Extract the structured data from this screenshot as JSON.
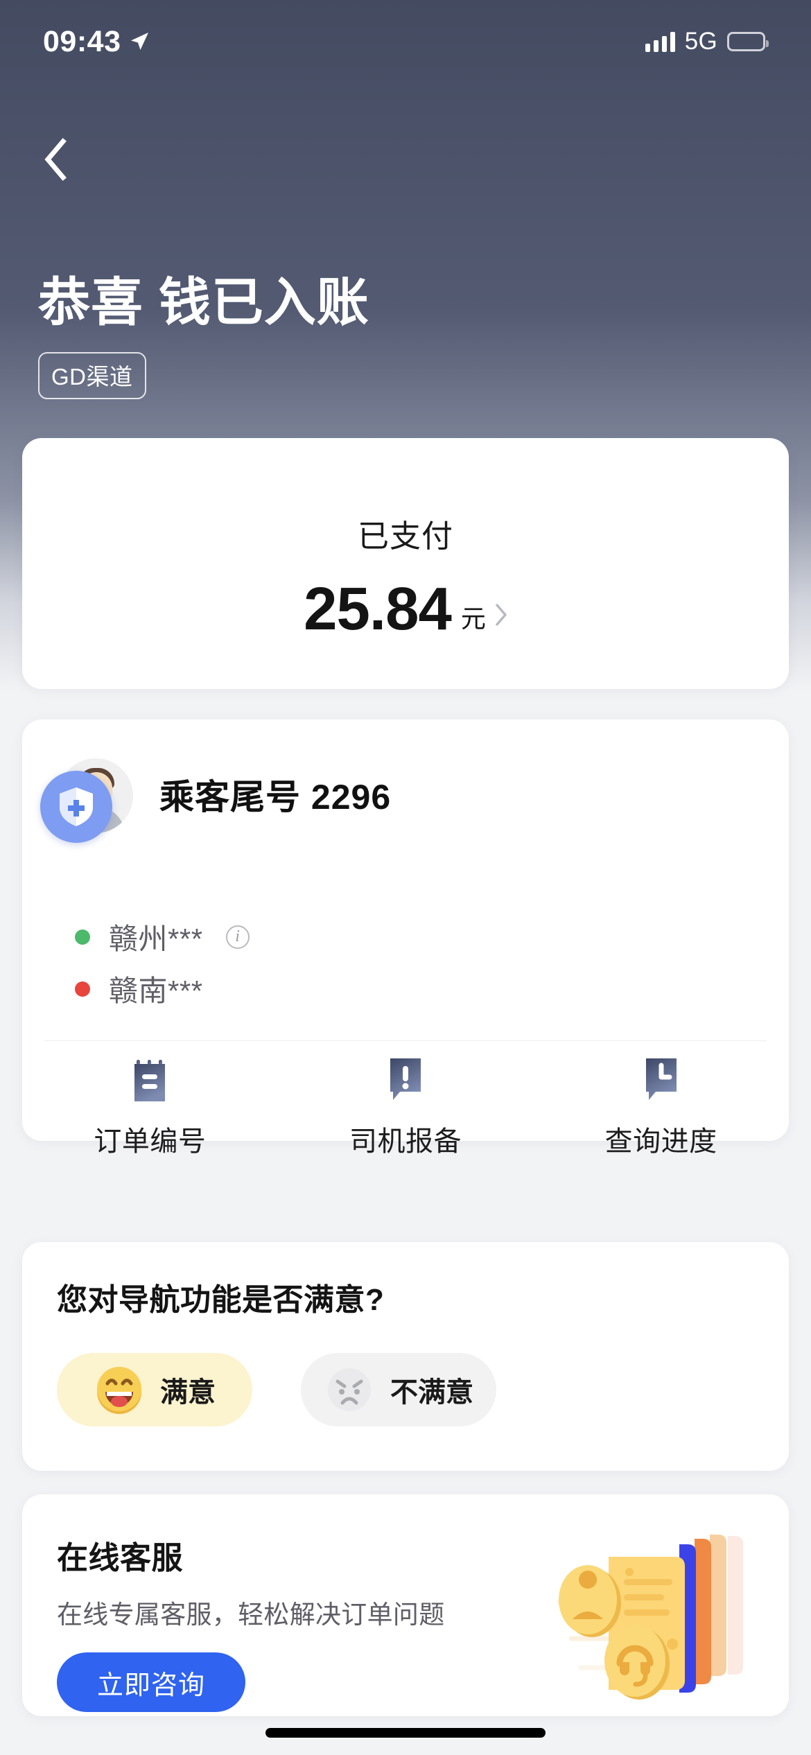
{
  "status_bar": {
    "time": "09:43",
    "location_arrow": "location-arrow-icon",
    "signal": "signal-bars-icon",
    "network": "5G",
    "battery": "battery-icon"
  },
  "navbar": {
    "back": "back-chevron-icon"
  },
  "header": {
    "title": "恭喜 钱已入账",
    "badge": "GD渠道"
  },
  "payment": {
    "label": "已支付",
    "amount": "25.84",
    "unit": "元",
    "chevron": "chevron-right-icon"
  },
  "passenger": {
    "avatar": "passenger-avatar",
    "shield_badge": "shield-plus-icon",
    "name": "乘客尾号 2296",
    "origin": "赣州***",
    "origin_info": "info-icon",
    "destination": "赣南***"
  },
  "actions": [
    {
      "label": "订单编号",
      "icon": "order-note-icon"
    },
    {
      "label": "司机报备",
      "icon": "alert-bubble-icon"
    },
    {
      "label": "查询进度",
      "icon": "clock-bubble-icon"
    }
  ],
  "survey": {
    "question": "您对导航功能是否满意?",
    "options": [
      {
        "label": "满意",
        "icon": "happy-face-icon"
      },
      {
        "label": "不满意",
        "icon": "angry-face-icon"
      }
    ]
  },
  "service": {
    "title": "在线客服",
    "subtitle": "在线专属客服，轻松解决订单问题",
    "button": "立即咨询",
    "illustration": "customer-service-cards-illustration"
  },
  "colors": {
    "header_top": "#444b61",
    "page_bg": "#f2f3f5",
    "card_bg": "#ffffff",
    "accent_blue": "#2f63f0",
    "shield_blue": "#7d9cf2",
    "origin_dot": "#4cb96b",
    "dest_dot": "#e8453c",
    "pill_yes_bg": "#fcf3cf",
    "pill_no_bg": "#f2f2f3",
    "icon_slate": "#5b6480"
  }
}
